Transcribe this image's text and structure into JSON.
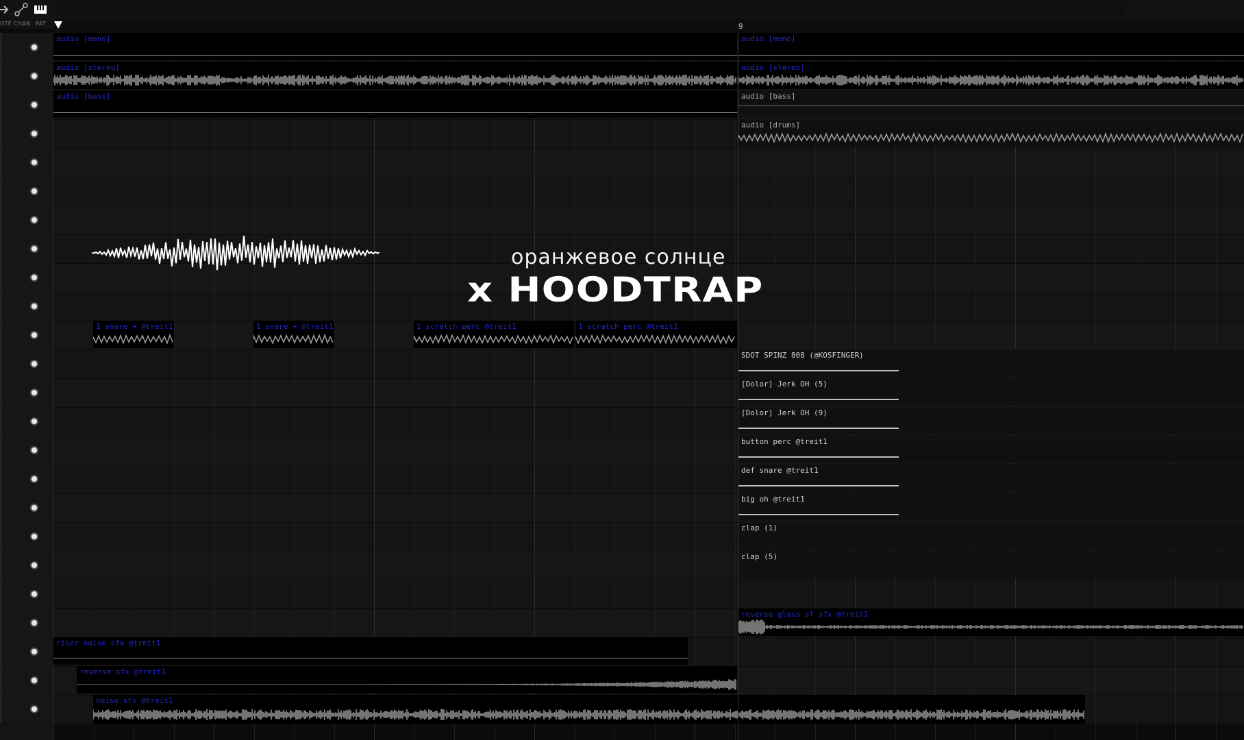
{
  "toolbar": {
    "labels": [
      "OTE",
      "CHAN",
      "PAT"
    ],
    "icons": [
      "arrow-icon",
      "link-icon",
      "piano-icon"
    ]
  },
  "ruler": {
    "marker": "9"
  },
  "tracks": {
    "count": 24
  },
  "clips": {
    "upper_left": [
      "audio [mono]",
      "audio [stereo]",
      "audio [bass]"
    ],
    "upper_right": [
      "audio [mono]",
      "audio [stereo]",
      "audio [bass]",
      "audio [drums]"
    ],
    "pattern_row": [
      "1 snare + @treit1",
      "1 snare + @treit1",
      "1 scratch perc @treit1",
      "1 scratch perc @treit1"
    ],
    "right_patterns": [
      "SDOT SPINZ 808 (@KOSFINGER)",
      "[Dolor] Jerk OH (5)",
      "[Dolor] Jerk OH (9)",
      "button perc @treit1",
      "def snare @treit1",
      "big oh @treit1",
      "clap (1)",
      "clap (5)"
    ],
    "lower_right": "reverse glass sf sfx @treit1",
    "lower_left": [
      "riser noise sfx @treit1",
      "reverse sfx @treit1",
      "noise sfx @treit1"
    ]
  },
  "overlay": {
    "subtitle": "оранжевое солнце",
    "title": "x HOODTRAP"
  },
  "colors": {
    "clip_title_blue": "#2326c8",
    "background": "#0b0b0b",
    "grid_line": "#2c2c2c"
  }
}
